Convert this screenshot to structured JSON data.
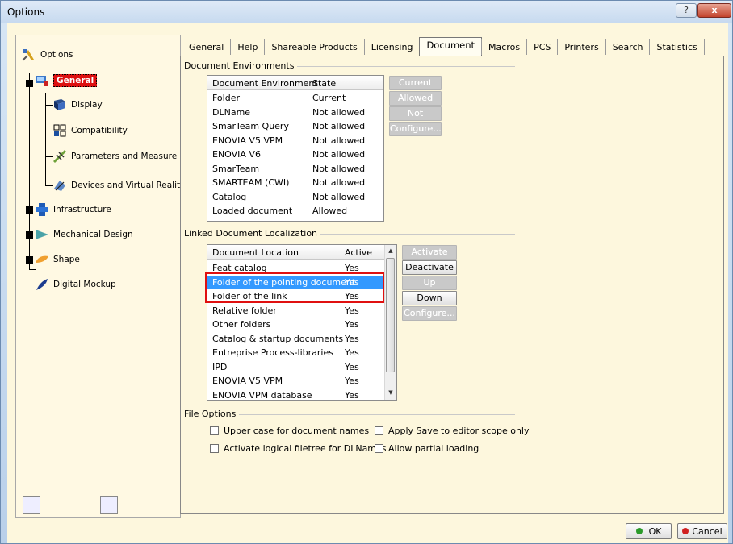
{
  "window": {
    "title": "Options",
    "help_glyph": "?",
    "close_glyph": "x"
  },
  "tree": {
    "root": {
      "label": "Options",
      "icon": "options-icon"
    },
    "items": [
      {
        "label": "General",
        "icon": "general-icon",
        "selected": true
      },
      {
        "label": "Display",
        "icon": "display-icon"
      },
      {
        "label": "Compatibility",
        "icon": "compatibility-icon"
      },
      {
        "label": "Parameters and Measure",
        "icon": "parameters-icon"
      },
      {
        "label": "Devices and Virtual Reality",
        "icon": "devices-icon"
      },
      {
        "label": "Infrastructure",
        "icon": "infrastructure-icon"
      },
      {
        "label": "Mechanical Design",
        "icon": "mechanical-design-icon"
      },
      {
        "label": "Shape",
        "icon": "shape-icon"
      },
      {
        "label": "Digital Mockup",
        "icon": "digital-mockup-icon"
      }
    ]
  },
  "tabs": [
    "General",
    "Help",
    "Shareable Products",
    "Licensing",
    "Document",
    "Macros",
    "PCS",
    "Printers",
    "Search",
    "Statistics"
  ],
  "active_tab": "Document",
  "document_environments": {
    "title": "Document Environments",
    "headers": [
      "Document Environment",
      "State"
    ],
    "rows": [
      [
        "Folder",
        "Current"
      ],
      [
        "DLName",
        "Not allowed"
      ],
      [
        "SmarTeam Query",
        "Not allowed"
      ],
      [
        "ENOVIA V5 VPM",
        "Not allowed"
      ],
      [
        "ENOVIA V6",
        "Not allowed"
      ],
      [
        "SmarTeam",
        "Not allowed"
      ],
      [
        "SMARTEAM (CWI)",
        "Not allowed"
      ],
      [
        "Catalog",
        "Not allowed"
      ],
      [
        "Loaded document",
        "Allowed"
      ]
    ],
    "buttons": [
      "Current",
      "Allowed",
      "Not allowed",
      "Configure..."
    ]
  },
  "linked_document_localization": {
    "title": "Linked Document Localization",
    "headers": [
      "Document Location",
      "Active"
    ],
    "rows": [
      [
        "Feat catalog",
        "Yes"
      ],
      [
        "Folder of the pointing document",
        "Yes"
      ],
      [
        "Folder of the link",
        "Yes"
      ],
      [
        "Relative folder",
        "Yes"
      ],
      [
        "Other folders",
        "Yes"
      ],
      [
        "Catalog & startup documents",
        "Yes"
      ],
      [
        "Entreprise Process-libraries",
        "Yes"
      ],
      [
        "IPD",
        "Yes"
      ],
      [
        "ENOVIA V5 VPM",
        "Yes"
      ],
      [
        "ENOVIA VPM  database",
        "Yes"
      ]
    ],
    "selected_row": 1,
    "buttons": [
      "Activate",
      "Deactivate",
      "Up",
      "Down",
      "Configure..."
    ]
  },
  "file_options": {
    "title": "File Options",
    "checkboxes": [
      {
        "label": "Upper case for document names",
        "checked": false
      },
      {
        "label": "Apply Save to editor scope only",
        "checked": false
      },
      {
        "label": "Activate logical filetree for DLNames",
        "checked": false
      },
      {
        "label": "Allow partial loading",
        "checked": false
      }
    ]
  },
  "footer": {
    "ok_label": "OK",
    "cancel_label": "Cancel",
    "ok_color": "#2a9a2a",
    "cancel_color": "#d02020"
  },
  "colors": {
    "panel_bg": "#fdf7dd",
    "selection": "#3399ff",
    "highlight_box": "#e01010",
    "tree_selected": "#d11111"
  }
}
